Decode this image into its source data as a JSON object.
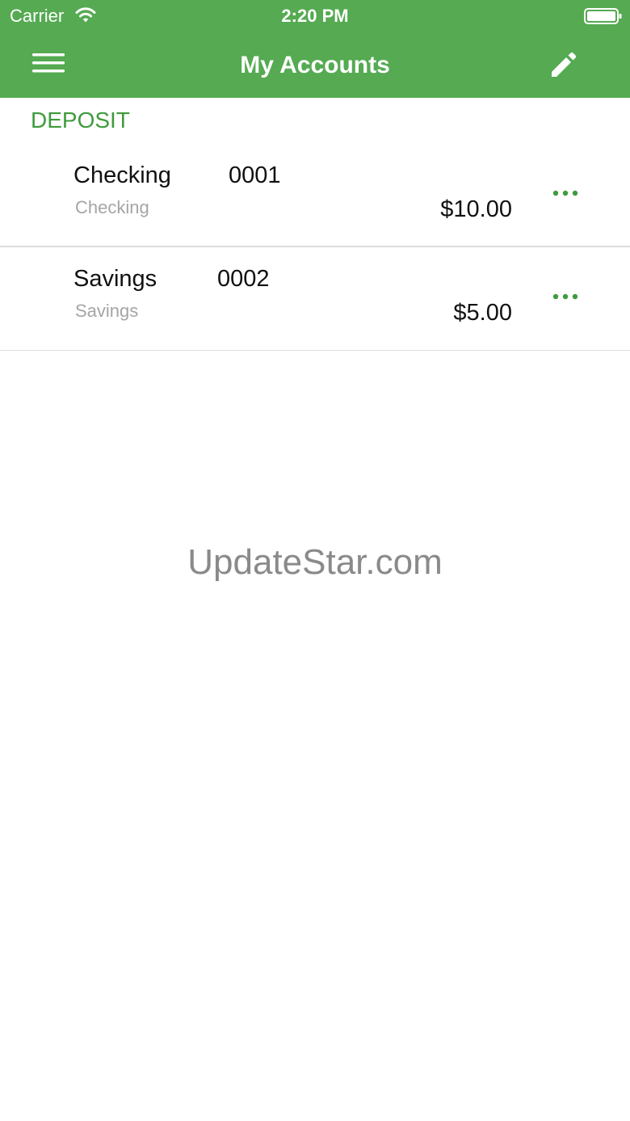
{
  "status_bar": {
    "carrier": "Carrier",
    "time": "2:20 PM"
  },
  "nav": {
    "title": "My Accounts",
    "left_icon": "menu-icon",
    "right_icon": "pencil-icon"
  },
  "section": {
    "title": "DEPOSIT"
  },
  "accounts": [
    {
      "name": "Checking",
      "number": "0001",
      "type": "Checking",
      "balance": "$10.00"
    },
    {
      "name": "Savings",
      "number": "0002",
      "type": "Savings",
      "balance": "$5.00"
    }
  ],
  "watermark": "UpdateStar.com",
  "colors": {
    "header_green": "#55aa52",
    "section_green": "#3f9b3d",
    "more_dots_green": "#3f9b3d",
    "secondary_text": "#a5a5a5"
  }
}
